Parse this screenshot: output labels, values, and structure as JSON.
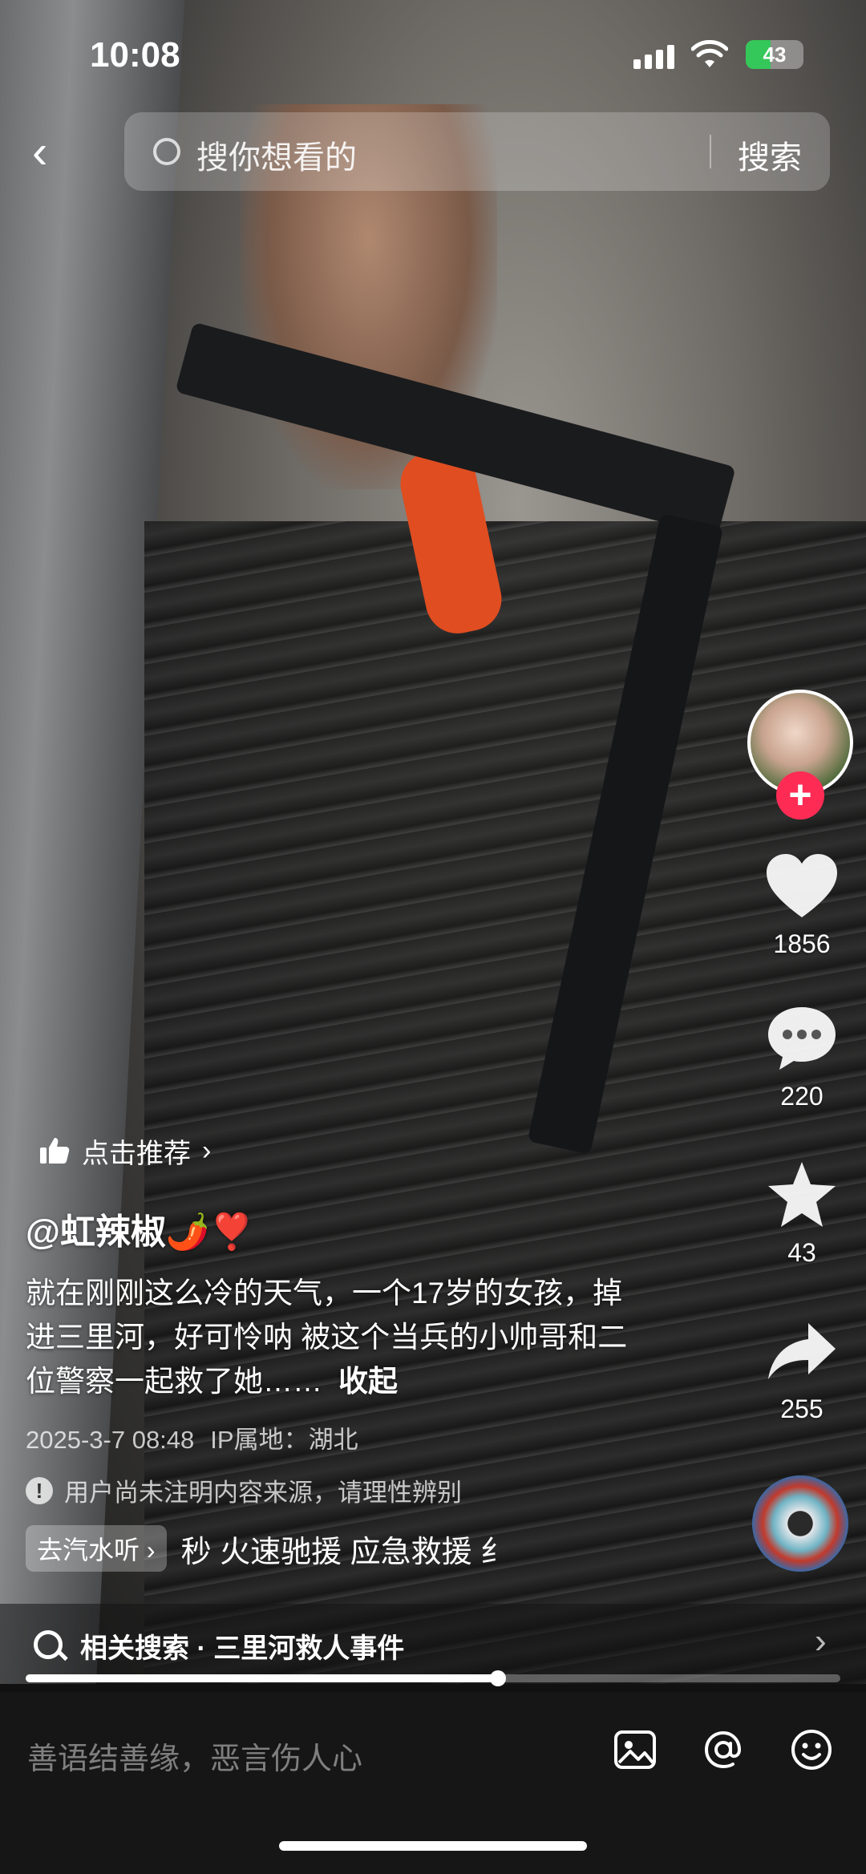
{
  "status_bar": {
    "time": "10:08",
    "battery": "43",
    "battery_level_percent": 43
  },
  "search": {
    "placeholder": "搜你想看的",
    "button": "搜索"
  },
  "side_actions": {
    "likes": "1856",
    "comments": "220",
    "favorites": "43",
    "shares": "255",
    "follow_symbol": "+"
  },
  "video_info": {
    "recommend_label": "点击推荐",
    "author": "@虹辣椒🌶️❣️",
    "caption": "就在刚刚这么冷的天气，一个17岁的女孩，掉进三里河，好可怜呐  被这个当兵的小帅哥和二位警察一起救了她……",
    "collapse_label": "收起",
    "date": "2025-3-7 08:48",
    "ip_location": "IP属地：湖北",
    "source_warning": "用户尚未注明内容来源，请理性辨别",
    "tag_pill": "去汽水听",
    "tag_text": "秒 火速驰援 应急救援 纟"
  },
  "related_search": {
    "label": "相关搜索 · 三里河救人事件"
  },
  "playback": {
    "progress_fraction": 0.58
  },
  "comment_bar": {
    "placeholder": "善语结善缘，恶言伤人心"
  },
  "colors": {
    "follow": "#fe2c55",
    "battery": "#34c759"
  }
}
